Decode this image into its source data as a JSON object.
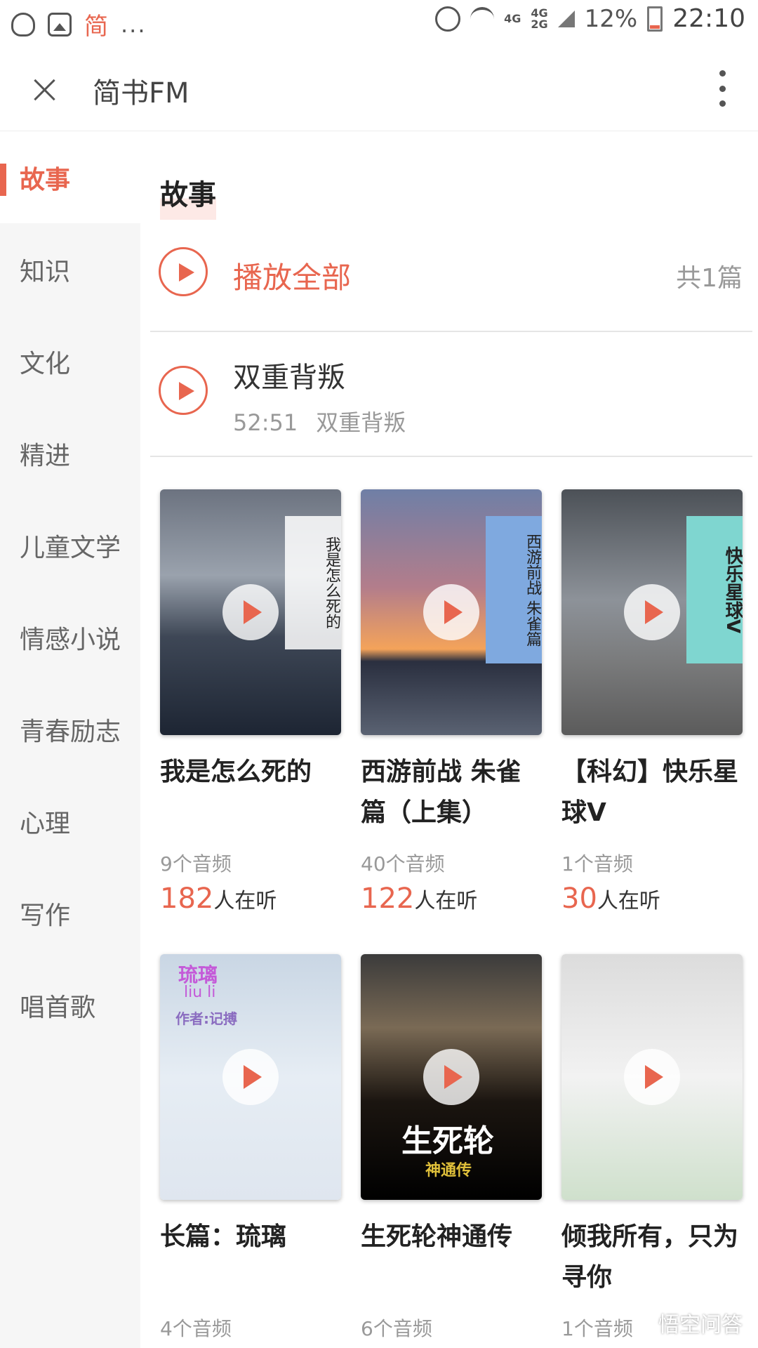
{
  "statusbar": {
    "app_label": "简",
    "overflow": "...",
    "network": "4G",
    "network2": "4G",
    "network3": "2G",
    "battery": "12%",
    "time": "22:10"
  },
  "header": {
    "title": "简书FM"
  },
  "sidebar": {
    "items": [
      {
        "label": "故事"
      },
      {
        "label": "知识"
      },
      {
        "label": "文化"
      },
      {
        "label": "精进"
      },
      {
        "label": "儿童文学"
      },
      {
        "label": "情感小说"
      },
      {
        "label": "青春励志"
      },
      {
        "label": "心理"
      },
      {
        "label": "写作"
      },
      {
        "label": "唱首歌"
      }
    ]
  },
  "main": {
    "section_title": "故事",
    "play_all": "播放全部",
    "total": "共1篇",
    "track": {
      "title": "双重背叛",
      "duration": "52:51",
      "subtitle": "双重背叛"
    },
    "books": [
      {
        "title": "我是怎么死的",
        "count": "9个音频",
        "listeners_num": "182",
        "listeners_suffix": "人在听",
        "cover_text": "我是怎么死的"
      },
      {
        "title": "西游前战 朱雀篇（上集）",
        "count": "40个音频",
        "listeners_num": "122",
        "listeners_suffix": "人在听",
        "cover_text": "西游前战 朱雀篇"
      },
      {
        "title": "【科幻】快乐星球V",
        "count": "1个音频",
        "listeners_num": "30",
        "listeners_suffix": "人在听",
        "cover_text": "快乐星球V"
      },
      {
        "title": "长篇：琉璃",
        "count": "4个音频",
        "listeners_num": "",
        "listeners_suffix": "",
        "cover_text": "琉璃",
        "cover_sub": "liu li",
        "cover_author": "作者:记搏"
      },
      {
        "title": "生死轮神通传",
        "count": "6个音频",
        "listeners_num": "",
        "listeners_suffix": "",
        "cover_text": "生死轮",
        "cover_sub": "神通传"
      },
      {
        "title": "倾我所有，只为寻你",
        "count": "1个音频",
        "listeners_num": "",
        "listeners_suffix": "",
        "cover_text": ""
      }
    ]
  },
  "watermark": "悟空问答",
  "colors": {
    "accent": "#e8664f",
    "sidebar_bg": "#f6f6f6"
  }
}
